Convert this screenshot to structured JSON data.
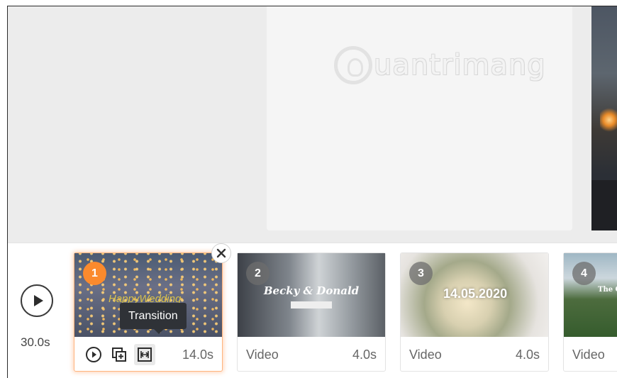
{
  "watermark": {
    "text": "uantrimang",
    "icon": "lightbulb-icon"
  },
  "timeline": {
    "total_duration": "30.0s",
    "play_icon": "play-icon",
    "clips": [
      {
        "number": "1",
        "thumbnail_text": "HappyWedding",
        "duration": "14.0s",
        "active": true
      },
      {
        "number": "2",
        "thumbnail_text": "Becky & Donald",
        "type": "Video",
        "duration": "4.0s"
      },
      {
        "number": "3",
        "thumbnail_text": "14.05.2020",
        "type": "Video",
        "duration": "4.0s"
      },
      {
        "number": "4",
        "thumbnail_text": "The O Sar",
        "type": "Video"
      }
    ],
    "tooltip": "Transition",
    "clip_controls": [
      "play-circle-icon",
      "duplicate-icon",
      "transition-icon"
    ],
    "close_icon": "close-icon"
  },
  "colors": {
    "active_accent": "#fb8a2d",
    "tooltip_bg": "#2f3237"
  }
}
